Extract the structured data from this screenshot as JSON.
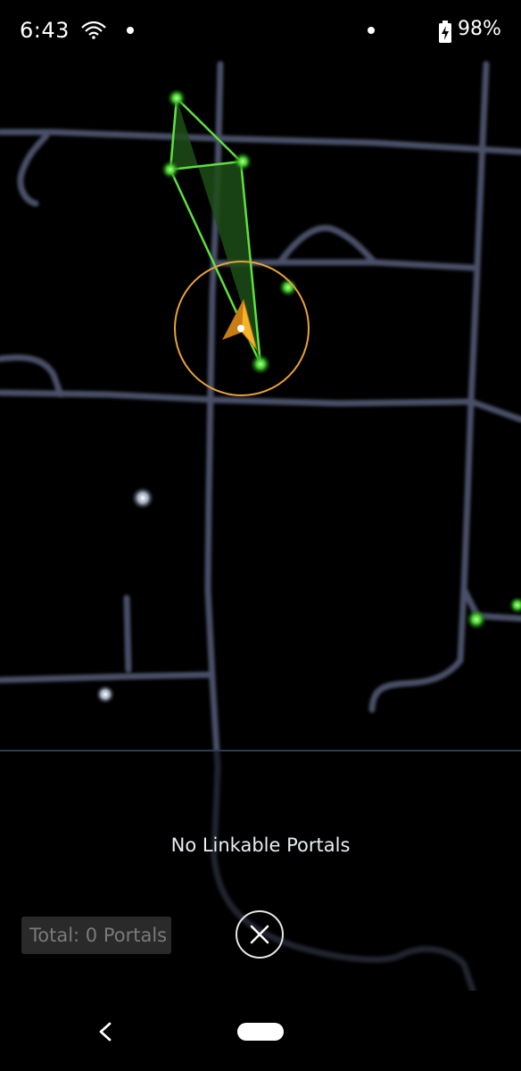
{
  "status_bar": {
    "time": "6:43",
    "battery": "98%",
    "icons": [
      "wifi-icon",
      "notification-dot-icon",
      "notification-dot-icon",
      "battery-charging-icon"
    ]
  },
  "map": {
    "player_marker": "player-arrow-icon",
    "portal_icons": [
      "green-portal-icon",
      "neutral-portal-icon"
    ],
    "colors": {
      "road": "#4a5068",
      "link": "#5de23d",
      "field": "#1d4d18",
      "player_ring": "#e8a23b",
      "player_arrow": "#f5b32a"
    }
  },
  "panel": {
    "message": "No Linkable Portals",
    "total": "Total: 0 Portals",
    "close_icon": "close-icon"
  },
  "nav_bar": {
    "back_icon": "back-icon",
    "home_icon": "home-pill-icon"
  }
}
